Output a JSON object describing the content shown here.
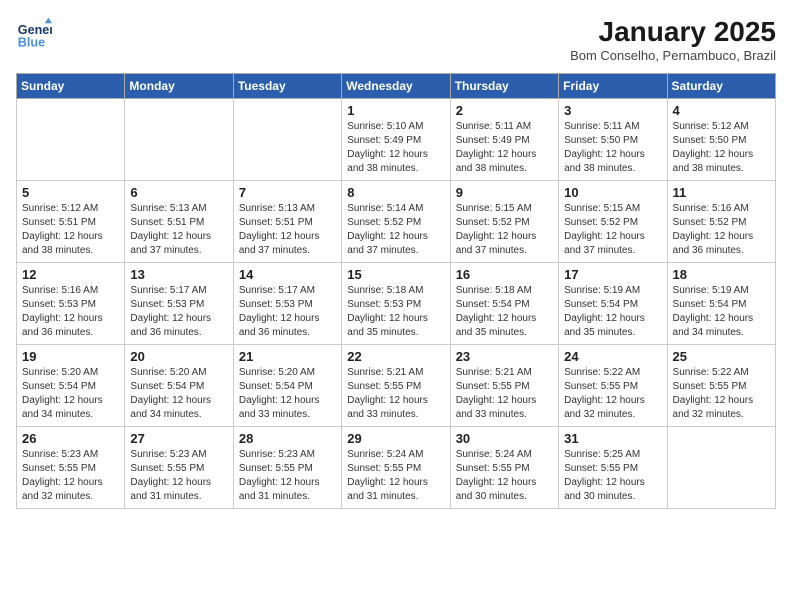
{
  "header": {
    "logo_line1": "General",
    "logo_line2": "Blue",
    "month": "January 2025",
    "location": "Bom Conselho, Pernambuco, Brazil"
  },
  "weekdays": [
    "Sunday",
    "Monday",
    "Tuesday",
    "Wednesday",
    "Thursday",
    "Friday",
    "Saturday"
  ],
  "weeks": [
    [
      {
        "day": "",
        "info": ""
      },
      {
        "day": "",
        "info": ""
      },
      {
        "day": "",
        "info": ""
      },
      {
        "day": "1",
        "info": "Sunrise: 5:10 AM\nSunset: 5:49 PM\nDaylight: 12 hours\nand 38 minutes."
      },
      {
        "day": "2",
        "info": "Sunrise: 5:11 AM\nSunset: 5:49 PM\nDaylight: 12 hours\nand 38 minutes."
      },
      {
        "day": "3",
        "info": "Sunrise: 5:11 AM\nSunset: 5:50 PM\nDaylight: 12 hours\nand 38 minutes."
      },
      {
        "day": "4",
        "info": "Sunrise: 5:12 AM\nSunset: 5:50 PM\nDaylight: 12 hours\nand 38 minutes."
      }
    ],
    [
      {
        "day": "5",
        "info": "Sunrise: 5:12 AM\nSunset: 5:51 PM\nDaylight: 12 hours\nand 38 minutes."
      },
      {
        "day": "6",
        "info": "Sunrise: 5:13 AM\nSunset: 5:51 PM\nDaylight: 12 hours\nand 37 minutes."
      },
      {
        "day": "7",
        "info": "Sunrise: 5:13 AM\nSunset: 5:51 PM\nDaylight: 12 hours\nand 37 minutes."
      },
      {
        "day": "8",
        "info": "Sunrise: 5:14 AM\nSunset: 5:52 PM\nDaylight: 12 hours\nand 37 minutes."
      },
      {
        "day": "9",
        "info": "Sunrise: 5:15 AM\nSunset: 5:52 PM\nDaylight: 12 hours\nand 37 minutes."
      },
      {
        "day": "10",
        "info": "Sunrise: 5:15 AM\nSunset: 5:52 PM\nDaylight: 12 hours\nand 37 minutes."
      },
      {
        "day": "11",
        "info": "Sunrise: 5:16 AM\nSunset: 5:52 PM\nDaylight: 12 hours\nand 36 minutes."
      }
    ],
    [
      {
        "day": "12",
        "info": "Sunrise: 5:16 AM\nSunset: 5:53 PM\nDaylight: 12 hours\nand 36 minutes."
      },
      {
        "day": "13",
        "info": "Sunrise: 5:17 AM\nSunset: 5:53 PM\nDaylight: 12 hours\nand 36 minutes."
      },
      {
        "day": "14",
        "info": "Sunrise: 5:17 AM\nSunset: 5:53 PM\nDaylight: 12 hours\nand 36 minutes."
      },
      {
        "day": "15",
        "info": "Sunrise: 5:18 AM\nSunset: 5:53 PM\nDaylight: 12 hours\nand 35 minutes."
      },
      {
        "day": "16",
        "info": "Sunrise: 5:18 AM\nSunset: 5:54 PM\nDaylight: 12 hours\nand 35 minutes."
      },
      {
        "day": "17",
        "info": "Sunrise: 5:19 AM\nSunset: 5:54 PM\nDaylight: 12 hours\nand 35 minutes."
      },
      {
        "day": "18",
        "info": "Sunrise: 5:19 AM\nSunset: 5:54 PM\nDaylight: 12 hours\nand 34 minutes."
      }
    ],
    [
      {
        "day": "19",
        "info": "Sunrise: 5:20 AM\nSunset: 5:54 PM\nDaylight: 12 hours\nand 34 minutes."
      },
      {
        "day": "20",
        "info": "Sunrise: 5:20 AM\nSunset: 5:54 PM\nDaylight: 12 hours\nand 34 minutes."
      },
      {
        "day": "21",
        "info": "Sunrise: 5:20 AM\nSunset: 5:54 PM\nDaylight: 12 hours\nand 33 minutes."
      },
      {
        "day": "22",
        "info": "Sunrise: 5:21 AM\nSunset: 5:55 PM\nDaylight: 12 hours\nand 33 minutes."
      },
      {
        "day": "23",
        "info": "Sunrise: 5:21 AM\nSunset: 5:55 PM\nDaylight: 12 hours\nand 33 minutes."
      },
      {
        "day": "24",
        "info": "Sunrise: 5:22 AM\nSunset: 5:55 PM\nDaylight: 12 hours\nand 32 minutes."
      },
      {
        "day": "25",
        "info": "Sunrise: 5:22 AM\nSunset: 5:55 PM\nDaylight: 12 hours\nand 32 minutes."
      }
    ],
    [
      {
        "day": "26",
        "info": "Sunrise: 5:23 AM\nSunset: 5:55 PM\nDaylight: 12 hours\nand 32 minutes."
      },
      {
        "day": "27",
        "info": "Sunrise: 5:23 AM\nSunset: 5:55 PM\nDaylight: 12 hours\nand 31 minutes."
      },
      {
        "day": "28",
        "info": "Sunrise: 5:23 AM\nSunset: 5:55 PM\nDaylight: 12 hours\nand 31 minutes."
      },
      {
        "day": "29",
        "info": "Sunrise: 5:24 AM\nSunset: 5:55 PM\nDaylight: 12 hours\nand 31 minutes."
      },
      {
        "day": "30",
        "info": "Sunrise: 5:24 AM\nSunset: 5:55 PM\nDaylight: 12 hours\nand 30 minutes."
      },
      {
        "day": "31",
        "info": "Sunrise: 5:25 AM\nSunset: 5:55 PM\nDaylight: 12 hours\nand 30 minutes."
      },
      {
        "day": "",
        "info": ""
      }
    ]
  ]
}
